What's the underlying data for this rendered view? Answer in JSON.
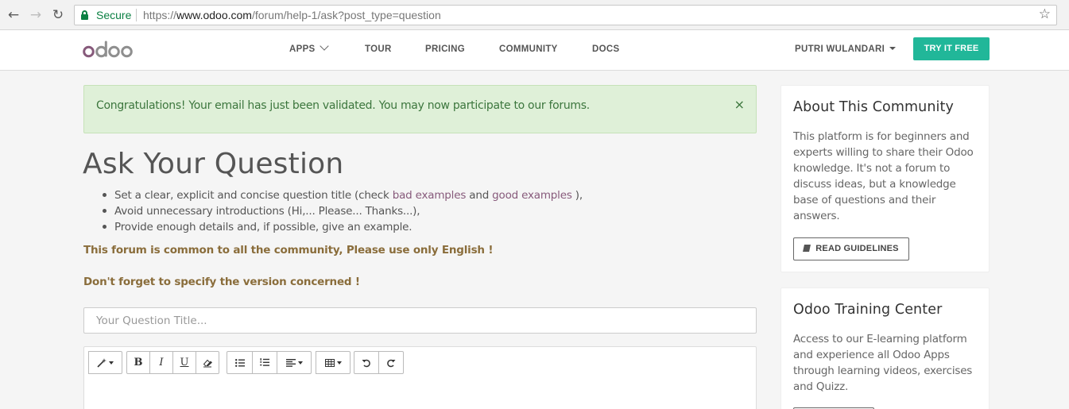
{
  "browser": {
    "secure_label": "Secure",
    "url_prefix": "https://",
    "url_host": "www.odoo.com",
    "url_path": "/forum/help-1/ask?post_type=question"
  },
  "header": {
    "logo_text": "odoo",
    "nav": [
      {
        "label": "APPS"
      },
      {
        "label": "TOUR"
      },
      {
        "label": "PRICING"
      },
      {
        "label": "COMMUNITY"
      },
      {
        "label": "DOCS"
      }
    ],
    "user_name": "PUTRI WULANDARI",
    "cta_label": "TRY IT FREE"
  },
  "alert": {
    "message": "Congratulations! Your email has just been validated. You may now participate to our forums.",
    "close_symbol": "×"
  },
  "main": {
    "title": "Ask Your Question",
    "tips": {
      "tip1_prefix": "Set a clear, explicit and concise question title (check",
      "tip1_link1": "bad examples",
      "tip1_middle": "and",
      "tip1_link2": "good examples",
      "tip1_suffix": "),",
      "tip2": "Avoid unnecessary introductions (Hi,... Please... Thanks...),",
      "tip3": "Provide enough details and, if possible, give an example."
    },
    "note_english": "This forum is common to all the community, Please use only English !",
    "note_version": "Don't forget to specify the version concerned !",
    "title_input": {
      "placeholder": "Your Question Title...",
      "value": ""
    },
    "editor_toolbar": {
      "bold": "B",
      "italic": "I",
      "underline": "U"
    }
  },
  "sidebar": {
    "about": {
      "title": "About This Community",
      "body": "This platform is for beginners and experts willing to share their Odoo knowledge. It's not a forum to discuss ideas, but a knowledge base of questions and their answers.",
      "button_label": "READ GUIDELINES"
    },
    "training": {
      "title": "Odoo Training Center",
      "body": "Access to our E-learning platform and experience all Odoo Apps through learning videos, exercises and Quizz."
    }
  },
  "colors": {
    "brand": "#875a7b",
    "cta": "#21b799",
    "alert_bg": "#dff0d8",
    "alert_text": "#3c763d",
    "note_text": "#8a6d3b",
    "secure_green": "#0b8043"
  }
}
